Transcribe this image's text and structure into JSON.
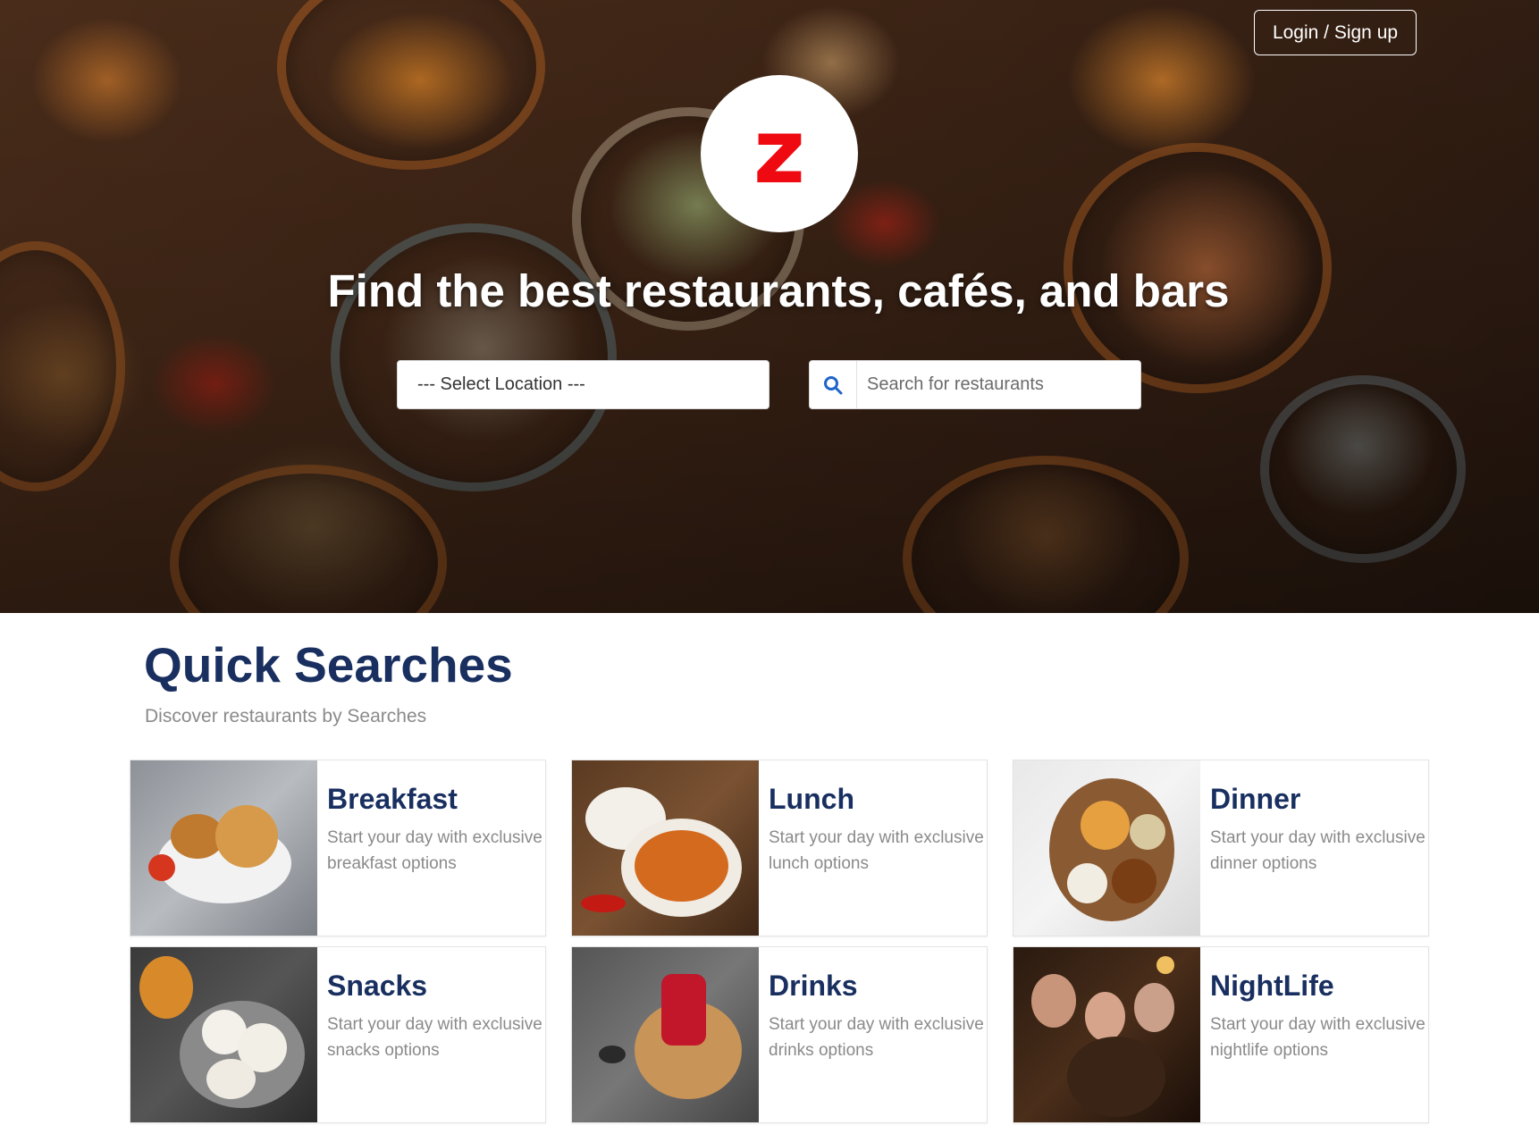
{
  "header": {
    "login_label": "Login / Sign up",
    "logo_letter": "z",
    "headline": "Find the best restaurants, cafés, and bars"
  },
  "search": {
    "location_label": "--- Select Location ---",
    "placeholder": "Search for restaurants"
  },
  "quick_searches": {
    "title": "Quick Searches",
    "subtitle": "Discover restaurants by Searches",
    "cards": [
      {
        "title": "Breakfast",
        "description": "Start your day with exclusive breakfast options"
      },
      {
        "title": "Lunch",
        "description": "Start your day with exclusive lunch options"
      },
      {
        "title": "Dinner",
        "description": "Start your day with exclusive dinner options"
      },
      {
        "title": "Snacks",
        "description": "Start your day with exclusive snacks options"
      },
      {
        "title": "Drinks",
        "description": "Start your day with exclusive drinks options"
      },
      {
        "title": "NightLife",
        "description": "Start your day with exclusive nightlife options"
      }
    ]
  },
  "colors": {
    "brand_red": "#ee0a10",
    "heading_navy": "#192f60",
    "muted_text": "#8a8a8a",
    "search_icon_blue": "#1f64c8"
  },
  "icons": {
    "search": "search-icon",
    "logo": "zomato-logo-icon"
  }
}
